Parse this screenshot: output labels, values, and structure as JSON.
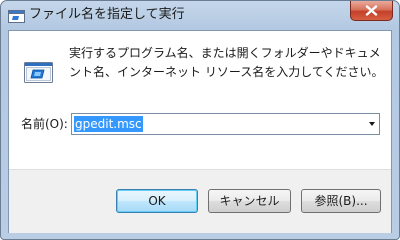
{
  "window": {
    "title": "ファイル名を指定して実行",
    "title_icon": "run-dialog-icon",
    "close_icon": "close-icon"
  },
  "dialog": {
    "icon": "run-icon",
    "description_line1": "実行するプログラム名、または開くフォルダーやドキュメ",
    "description_line2": "ント名、インターネット リソース名を入力してください。",
    "name_label": "名前(O):",
    "name_value": "gpedit.msc"
  },
  "buttons": {
    "ok": "OK",
    "cancel": "キャンセル",
    "browse": "参照(B)..."
  },
  "colors": {
    "selection": "#3399ff",
    "close_button": "#c4402a",
    "frame": "#b3c9e2"
  }
}
